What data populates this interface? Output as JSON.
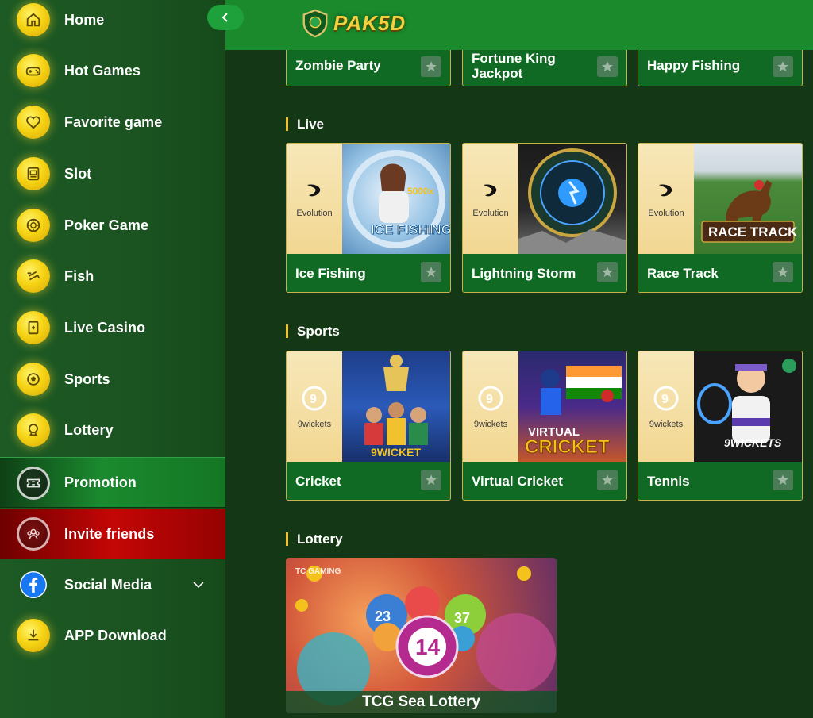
{
  "sidebar": {
    "items": [
      {
        "label": "Home",
        "icon": "home-icon"
      },
      {
        "label": "Hot Games",
        "icon": "gamepad-icon"
      },
      {
        "label": "Favorite game",
        "icon": "heart-icon"
      },
      {
        "label": "Slot",
        "icon": "slot-machine-icon"
      },
      {
        "label": "Poker Game",
        "icon": "poker-chip-icon"
      },
      {
        "label": "Fish",
        "icon": "fish-icon"
      },
      {
        "label": "Live Casino",
        "icon": "card-icon"
      },
      {
        "label": "Sports",
        "icon": "sports-ball-icon"
      },
      {
        "label": "Lottery",
        "icon": "lottery-icon"
      },
      {
        "label": "Promotion",
        "icon": "ticket-icon"
      },
      {
        "label": "Invite friends",
        "icon": "group-icon"
      },
      {
        "label": "Social Media",
        "icon": "facebook-icon"
      },
      {
        "label": "APP Download",
        "icon": "download-icon"
      }
    ]
  },
  "header": {
    "logo_text": "PAK5D"
  },
  "top_partial": [
    {
      "title": "Zombie Party"
    },
    {
      "title": "Fortune King Jackpot"
    },
    {
      "title": "Happy Fishing"
    }
  ],
  "sections": {
    "live": {
      "title": "Live",
      "games": [
        {
          "title": "Ice Fishing",
          "provider": "Evolution"
        },
        {
          "title": "Lightning Storm",
          "provider": "Evolution"
        },
        {
          "title": "Race Track",
          "provider": "Evolution"
        }
      ]
    },
    "sports": {
      "title": "Sports",
      "games": [
        {
          "title": "Cricket",
          "provider": "9wickets"
        },
        {
          "title": "Virtual Cricket",
          "provider": "9wickets"
        },
        {
          "title": "Tennis",
          "provider": "9wickets"
        }
      ]
    },
    "lottery": {
      "title": "Lottery",
      "games": [
        {
          "title": "TCG Sea Lottery",
          "provider": "TC GAMING"
        }
      ]
    }
  },
  "colors": {
    "accent_gold": "#f4c21d",
    "header_green": "#1a8a2c",
    "promo_green": "#1b8a2e",
    "invite_red": "#c40606"
  }
}
